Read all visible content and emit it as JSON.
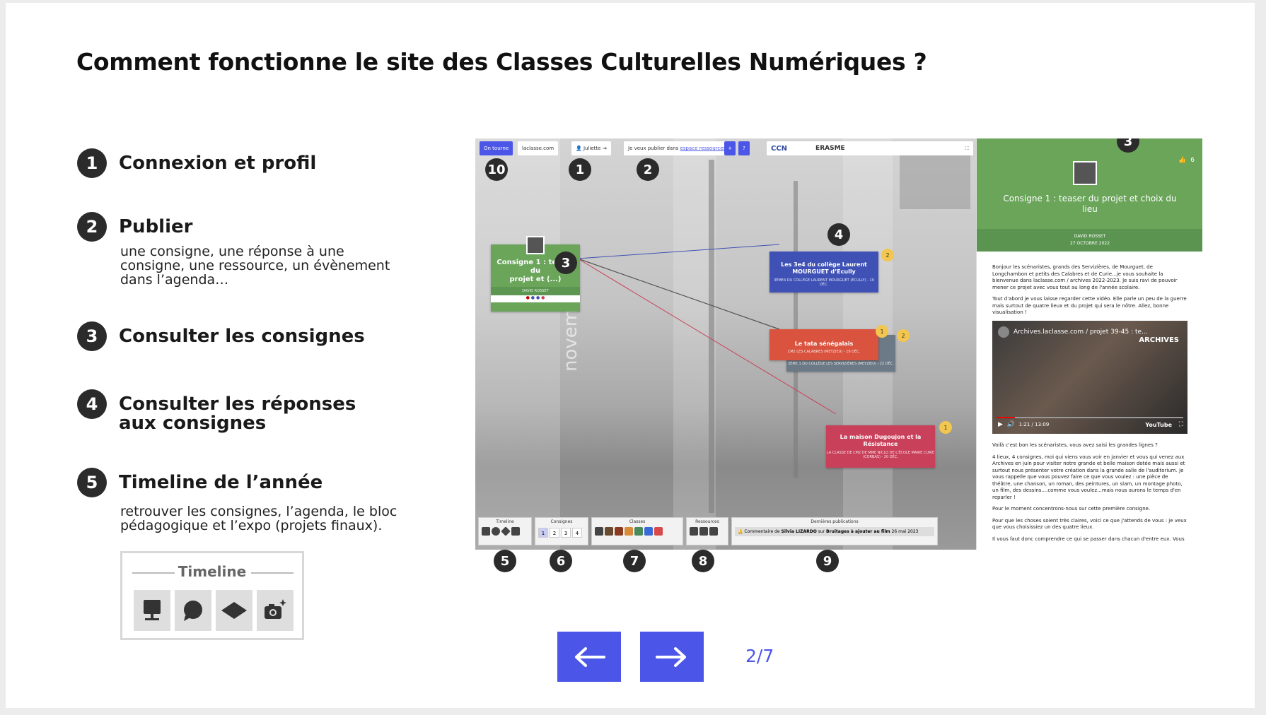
{
  "title": "Comment fonctionne le site des Classes Culturelles Numériques ?",
  "steps": [
    {
      "num": "1",
      "title": "Connexion et profil",
      "desc": ""
    },
    {
      "num": "2",
      "title": "Publier",
      "desc_lines": [
        "une consigne, une réponse à une",
        "consigne, une ressource, un évènement",
        "dans l’agenda…"
      ]
    },
    {
      "num": "3",
      "title": "Consulter les consignes"
    },
    {
      "num": "4",
      "title_lines": [
        "Consulter les réponses",
        "aux consignes"
      ]
    },
    {
      "num": "5",
      "title": "Timeline de l’année",
      "desc_lines": [
        "retrouver les consignes, l’agenda, le bloc",
        "pédagogique et l’expo (projets finaux)."
      ]
    }
  ],
  "timeline_box": {
    "title": "Timeline",
    "icons": [
      "presentation-board-icon",
      "speech-bubble-icon",
      "graduation-cap-icon",
      "camera-sparkle-icon"
    ]
  },
  "screenshot": {
    "topbar": {
      "on_tourne": "On tourne",
      "site": "laclasse.com",
      "user": "Juliette",
      "publish_prefix": "Je veux publier dans",
      "publish_link": "espace ressources",
      "logos": [
        "CCN",
        "ERASME"
      ]
    },
    "badges": [
      "10",
      "1",
      "2",
      "3",
      "4",
      "3"
    ],
    "bottom_badges": [
      "5",
      "6",
      "7",
      "8",
      "9"
    ],
    "cards": {
      "consigne": {
        "title_lines": [
          "Consigne 1 : teaser",
          "du",
          "projet et (...)"
        ],
        "author": "DAVID ROSSET"
      },
      "c3e4": {
        "title_lines": [
          "Les 3e4 du collège Laurent",
          "MOURGUET d’Ecully"
        ],
        "sub": "3ÈME4 DU COLLÈGE LAURENT MOURGUET (ECULLY) - 19 DÉC.",
        "count": "2"
      },
      "tata": {
        "title": "Le tata sénégalais",
        "sub": "CM2 LES CALABRES (MEYZIEU) - 19 DÉC.",
        "count": "1"
      },
      "tata_back": {
        "sub": "3ÈME 1 DU COLLÈGE LES SERVIZIÈRES (MEYZIEU) - 22 DÉC.",
        "count": "2"
      },
      "maison": {
        "title_lines": [
          "La maison Dugoujon et la",
          "Résistance"
        ],
        "sub": "LA CLASSE DE CM2 DE MME NICLO DE L'ÉCOLE MARIE CURIE (CORBAS) - 20 DÉC.",
        "count": "1"
      }
    },
    "watermark": "novembre",
    "bottom": {
      "timeline": "Timeline",
      "consignes": "Consignes",
      "consigne_numbers": [
        "1",
        "2",
        "3",
        "4"
      ],
      "classes": "Classes",
      "ressources": "Ressources",
      "dernieres": "Dernières publications",
      "last_pub_prefix": "Commentaire de",
      "last_pub_author": "Silvia LIZARDO",
      "last_pub_mid": "sur",
      "last_pub_target": "Bruitages à ajouter au film",
      "last_pub_date": "26 mai 2023"
    },
    "side": {
      "likes": "6",
      "title_lines": [
        "Consigne 1 : teaser du projet et choix du",
        "lieu"
      ],
      "author": "DAVID ROSSET",
      "date": "27 OCTOBRE 2022",
      "paragraphs": [
        "Bonjour les scénaristes, grands des Servizières, de Mourguet, de Longchambon et petits des Calabres et de Curie...je vous souhaite la bienvenue dans laclasse.com / archives 2022-2023. Je suis ravi de pouvoir mener ce projet avec vous tout au long de l'année scolaire.",
        "Tout d'abord je vous laisse regarder cette vidéo. Elle parle un peu de la guerre mais surtout de quatre lieux et du projet qui sera le nôtre. Allez, bonne visualisation !"
      ],
      "video_title": "Archives.laclasse.com / projet 39-45 : te...",
      "video_brand": "ARCHIVES",
      "video_time": "1:21 / 13:09",
      "video_platform": "YouTube",
      "paragraphs_after": [
        "Voilà c'est bon les scénaristes, vous avez saisi les grandes lignes ?",
        "4 lieux, 4 consignes, moi qui viens vous voir en janvier et vous qui venez aux Archives en juin pour visiter notre grande et belle maison dotée mais aussi et surtout nous présenter votre création dans la grande salle de l'auditorium. Je vous rappelle que vous pouvez faire ce que vous voulez : une pièce de théâtre, une chanson, un roman, des peintures, un slam, un montage photo, un film, des dessins....comme vous voulez...mais nous aurons le temps d'en reparler !",
        "Pour le moment concentrons-nous sur cette première consigne.",
        "Pour que les choses soient très claires, voici ce que j'attends de vous : je veux que vous choisissiez un des quatre lieux.",
        "Il vous faut donc comprendre ce qui se passer dans chacun d'entre eux. Vous"
      ]
    }
  },
  "pager": "2/7",
  "colors": {
    "accent": "#4b56e8",
    "green": "#6aa55a",
    "blue": "#3f51b5",
    "red": "#d9533f",
    "crimson": "#c9405a",
    "slate": "#6b7a86",
    "badge": "#2b2b2b"
  }
}
